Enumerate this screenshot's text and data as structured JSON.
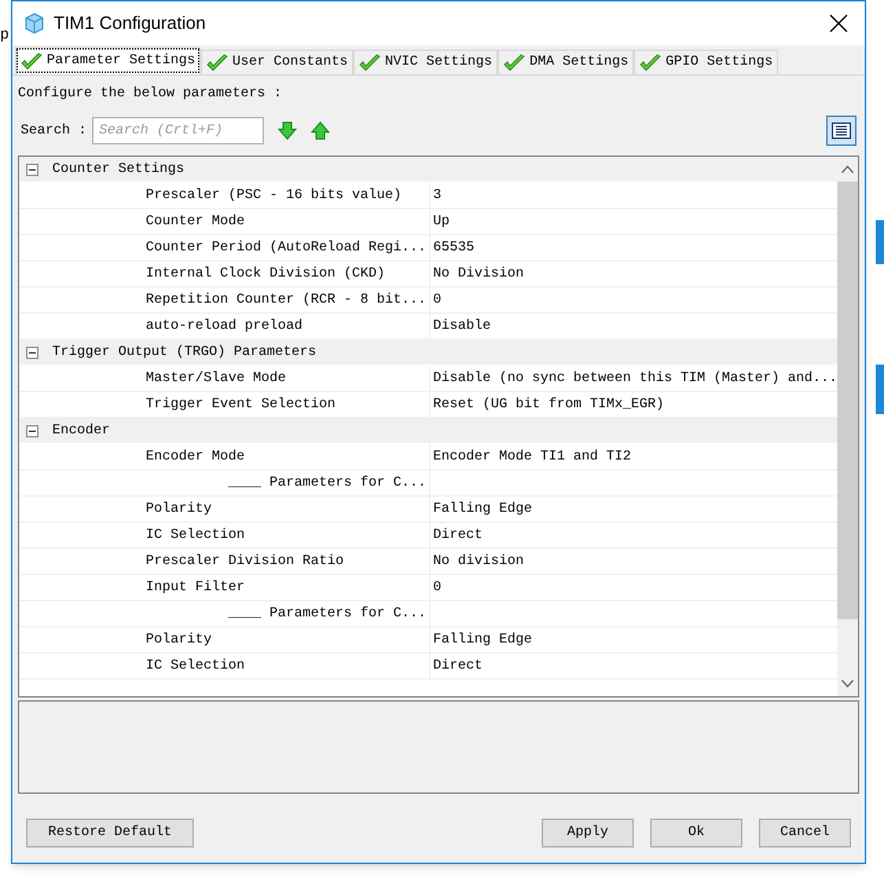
{
  "background_text": "p",
  "window": {
    "title": "TIM1 Configuration"
  },
  "tabs": [
    {
      "label": "Parameter Settings",
      "selected": true
    },
    {
      "label": "User Constants",
      "selected": false
    },
    {
      "label": "NVIC Settings",
      "selected": false
    },
    {
      "label": "DMA Settings",
      "selected": false
    },
    {
      "label": "GPIO Settings",
      "selected": false
    }
  ],
  "intro": "Configure the below parameters :",
  "search": {
    "label": "Search :",
    "placeholder": "Search (Crtl+F)"
  },
  "groups": [
    {
      "label": "Counter Settings",
      "expanded": true,
      "rows": [
        {
          "kind": "param",
          "name": "Prescaler (PSC - 16 bits value)",
          "value": "3"
        },
        {
          "kind": "param",
          "name": "Counter Mode",
          "value": "Up"
        },
        {
          "kind": "param",
          "name": "Counter Period (AutoReload Regi...",
          "value": "65535"
        },
        {
          "kind": "param",
          "name": "Internal Clock Division (CKD)",
          "value": "No Division"
        },
        {
          "kind": "param",
          "name": "Repetition Counter (RCR - 8 bit...",
          "value": "0"
        },
        {
          "kind": "param",
          "name": "auto-reload preload",
          "value": "Disable"
        }
      ]
    },
    {
      "label": "Trigger Output (TRGO) Parameters",
      "expanded": true,
      "rows": [
        {
          "kind": "param",
          "name": "Master/Slave Mode",
          "value": "Disable (no sync between this TIM (Master) and..."
        },
        {
          "kind": "param",
          "name": "Trigger Event Selection",
          "value": "Reset (UG bit from TIMx_EGR)"
        }
      ]
    },
    {
      "label": "Encoder",
      "expanded": true,
      "rows": [
        {
          "kind": "param",
          "name": "Encoder Mode",
          "value": "Encoder Mode TI1 and TI2"
        },
        {
          "kind": "subheader",
          "name": "____ Parameters for C..."
        },
        {
          "kind": "param",
          "name": "Polarity",
          "value": "Falling Edge"
        },
        {
          "kind": "param",
          "name": "IC Selection",
          "value": "Direct"
        },
        {
          "kind": "param",
          "name": "Prescaler Division Ratio",
          "value": "No division"
        },
        {
          "kind": "param",
          "name": "Input Filter",
          "value": "0"
        },
        {
          "kind": "subheader",
          "name": "____ Parameters for C..."
        },
        {
          "kind": "param",
          "name": "Polarity",
          "value": "Falling Edge"
        },
        {
          "kind": "param",
          "name": "IC Selection",
          "value": "Direct"
        }
      ]
    }
  ],
  "buttons": {
    "restore": "Restore Default",
    "apply": "Apply",
    "ok": "Ok",
    "cancel": "Cancel"
  }
}
